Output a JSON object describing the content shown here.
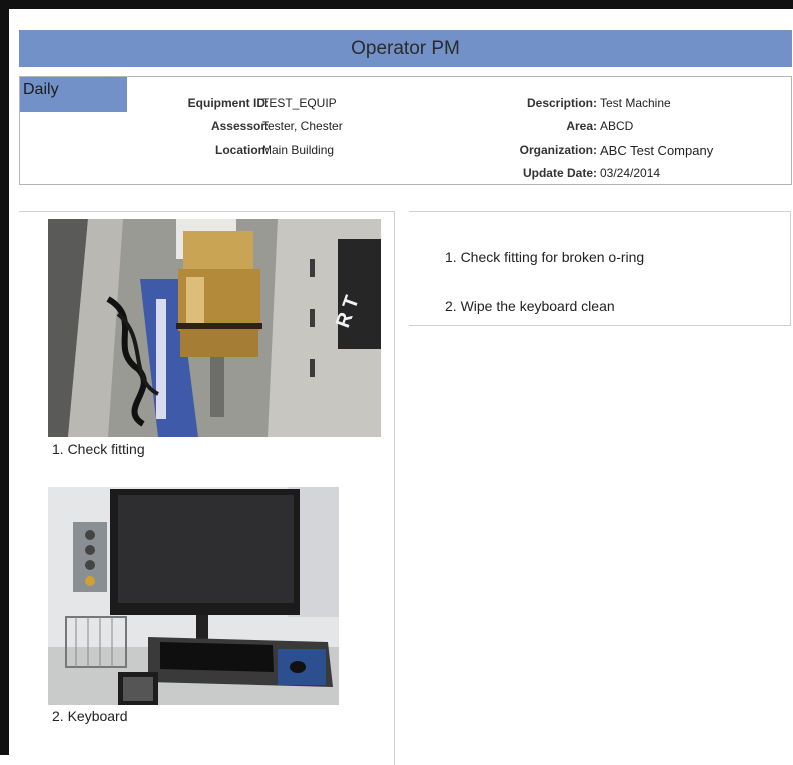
{
  "header": {
    "title": "Operator PM",
    "accent_color": "#7191c8"
  },
  "info": {
    "frequency": "Daily",
    "fields_left": [
      {
        "label": "Equipment ID:",
        "value": "TEST_EQUIP"
      },
      {
        "label": "Assessor:",
        "value": "Tester, Chester"
      },
      {
        "label": "Location:",
        "value": "Main Building"
      }
    ],
    "fields_right": [
      {
        "label": "Description:",
        "value": "Test Machine"
      },
      {
        "label": "Area:",
        "value": "ABCD"
      },
      {
        "label": "Organization:",
        "value": "ABC Test Company"
      },
      {
        "label": "Update Date:",
        "value": "03/24/2014"
      }
    ]
  },
  "photos": [
    {
      "caption": "1. Check fitting",
      "icon": "fitting-photo"
    },
    {
      "caption": "2. Keyboard",
      "icon": "keyboard-photo"
    }
  ],
  "steps": [
    "1. Check fitting for broken o-ring",
    "2. Wipe the keyboard clean"
  ]
}
